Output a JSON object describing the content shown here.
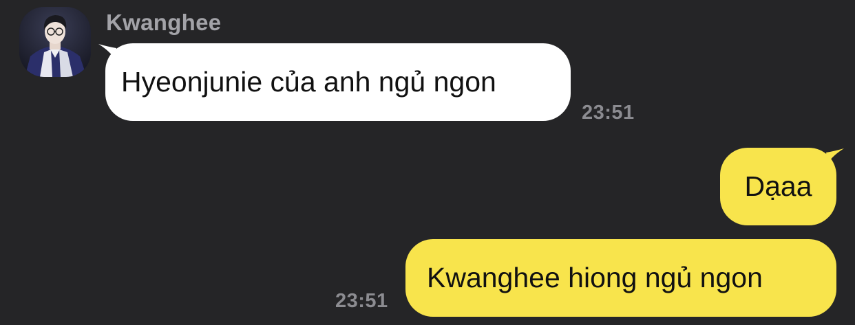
{
  "chat": {
    "incoming": {
      "sender_name": "Kwanghee",
      "avatar_icon": "profile-photo",
      "message": "Hyeonjunie của anh ngủ ngon",
      "time": "23:51"
    },
    "outgoing": [
      {
        "message": "Dạaa"
      },
      {
        "message": "Kwanghee hiong ngủ ngon",
        "time": "23:51"
      }
    ]
  },
  "colors": {
    "background": "#252527",
    "incoming_bubble": "#ffffff",
    "outgoing_bubble": "#f8e44c",
    "sender_name": "#a3a3a8",
    "timestamp": "#8c8c91"
  }
}
